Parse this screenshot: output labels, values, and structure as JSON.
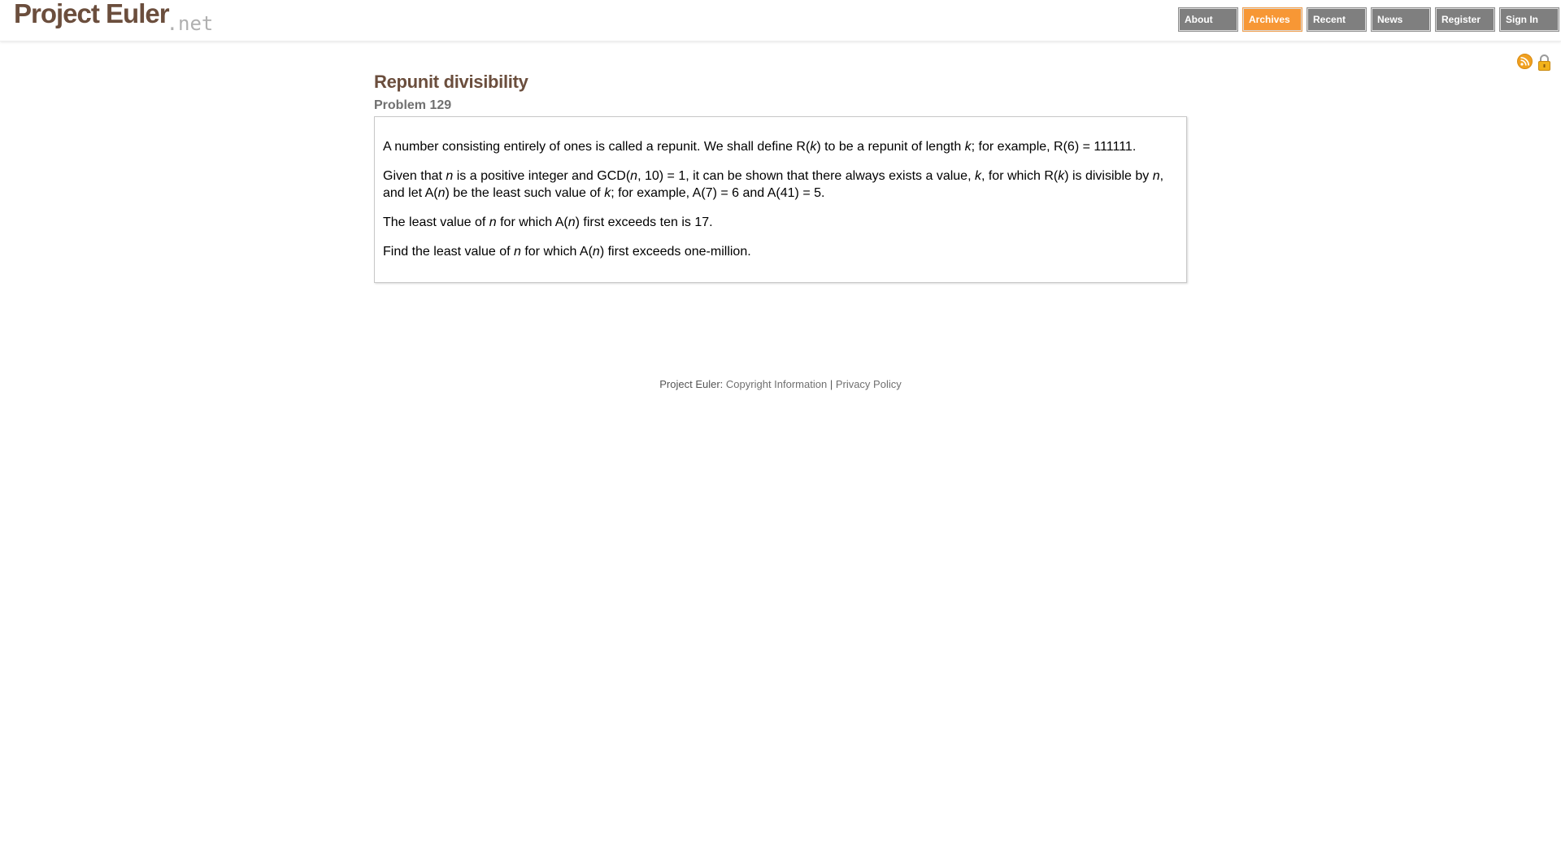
{
  "header": {
    "logo_main": "Project Euler",
    "logo_suffix": ".net",
    "nav": [
      {
        "label": "About",
        "active": false
      },
      {
        "label": "Archives",
        "active": true
      },
      {
        "label": "Recent",
        "active": false
      },
      {
        "label": "News",
        "active": false
      },
      {
        "label": "Register",
        "active": false
      },
      {
        "label": "Sign In",
        "active": false
      }
    ]
  },
  "icons": [
    "rss-icon",
    "lock-icon"
  ],
  "problem": {
    "title": "Repunit divisibility",
    "number": "Problem 129",
    "paragraphs": [
      [
        {
          "t": "A number consisting entirely of ones is called a repunit. We shall define R("
        },
        {
          "t": "k",
          "i": true
        },
        {
          "t": ") to be a repunit of length "
        },
        {
          "t": "k",
          "i": true
        },
        {
          "t": "; for example, R(6) = 111111."
        }
      ],
      [
        {
          "t": "Given that "
        },
        {
          "t": "n",
          "i": true
        },
        {
          "t": " is a positive integer and GCD("
        },
        {
          "t": "n",
          "i": true
        },
        {
          "t": ", 10) = 1, it can be shown that there always exists a value, "
        },
        {
          "t": "k",
          "i": true
        },
        {
          "t": ", for which R("
        },
        {
          "t": "k",
          "i": true
        },
        {
          "t": ") is divisible by "
        },
        {
          "t": "n",
          "i": true
        },
        {
          "t": ", and let A("
        },
        {
          "t": "n",
          "i": true
        },
        {
          "t": ") be the least such value of "
        },
        {
          "t": "k",
          "i": true
        },
        {
          "t": "; for example, A(7) = 6 and A(41) = 5."
        }
      ],
      [
        {
          "t": "The least value of "
        },
        {
          "t": "n",
          "i": true
        },
        {
          "t": " for which A("
        },
        {
          "t": "n",
          "i": true
        },
        {
          "t": ") first exceeds ten is 17."
        }
      ],
      [
        {
          "t": "Find the least value of "
        },
        {
          "t": "n",
          "i": true
        },
        {
          "t": " for which A("
        },
        {
          "t": "n",
          "i": true
        },
        {
          "t": ") first exceeds one-million."
        }
      ]
    ]
  },
  "footer": {
    "prefix": "Project Euler: ",
    "copyright_link": "Copyright Information",
    "separator": " | ",
    "privacy_link": "Privacy Policy"
  },
  "colors": {
    "brand_brown": "#6b4e3d",
    "nav_gray": "#7f7f7f",
    "nav_active_orange": "#f79735",
    "rss_orange": "#f0a020"
  }
}
